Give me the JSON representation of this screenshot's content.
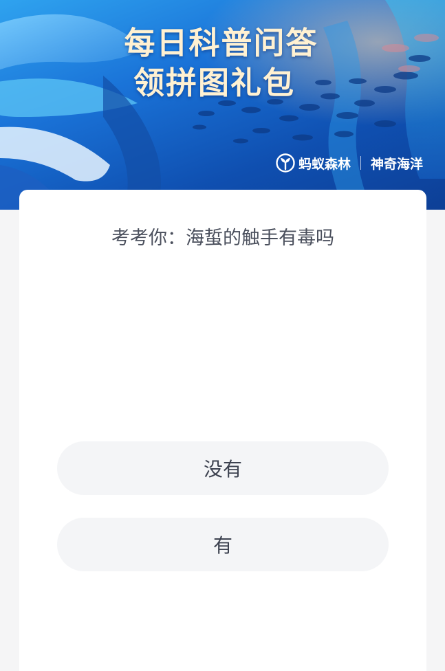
{
  "banner": {
    "title_line1": "每日科普问答",
    "title_line2": "领拼图礼包",
    "brand_primary": "蚂蚁森林",
    "brand_secondary": "神奇海洋",
    "logo_icon": "sprout-icon"
  },
  "quiz": {
    "question": "考考你：海蜇的触手有毒吗",
    "options": [
      {
        "label": "没有"
      },
      {
        "label": "有"
      }
    ]
  },
  "colors": {
    "banner_top": "#2fa3ef",
    "banner_bottom": "#0d3f96",
    "title_text": "#fff1d2",
    "page_bg": "#f5f5f6",
    "option_bg": "#f4f5f7",
    "question_text": "#4a4f5c"
  }
}
